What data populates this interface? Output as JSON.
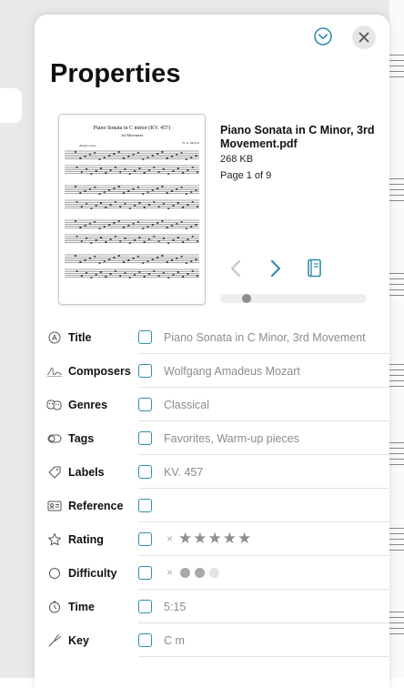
{
  "panel": {
    "title": "Properties"
  },
  "preview": {
    "file_name": "Piano Sonata in C Minor, 3rd Movement.pdf",
    "file_size": "268 KB",
    "page_info": "Page 1 of 9",
    "thumbnail": {
      "heading": "Piano Sonata in C minor (KV. 457)",
      "subheading": "3rd Movement",
      "tempo": "Allegro assai",
      "composer": "W. A. Mozart"
    }
  },
  "properties": [
    {
      "label": "Title",
      "icon": "title-icon",
      "value": "Piano Sonata in C Minor, 3rd Movement"
    },
    {
      "label": "Composers",
      "icon": "composer-signature-icon",
      "value": "Wolfgang Amadeus Mozart"
    },
    {
      "label": "Genres",
      "icon": "theater-masks-icon",
      "value": "Classical"
    },
    {
      "label": "Tags",
      "icon": "tag-toggle-icon",
      "value": "Favorites, Warm-up pieces"
    },
    {
      "label": "Labels",
      "icon": "label-tag-icon",
      "value": "KV. 457"
    },
    {
      "label": "Reference",
      "icon": "id-card-icon",
      "value": ""
    },
    {
      "label": "Rating",
      "icon": "star-icon",
      "value": "",
      "rating": 5
    },
    {
      "label": "Difficulty",
      "icon": "circle-icon",
      "value": "",
      "difficulty_level": 2,
      "difficulty_max": 3
    },
    {
      "label": "Time",
      "icon": "timer-icon",
      "value": "5:15"
    },
    {
      "label": "Key",
      "icon": "tuning-fork-icon",
      "value": "C m"
    }
  ],
  "rating_row": {
    "clear": "×",
    "stars": "★★★★★"
  },
  "difficulty_row": {
    "clear": "×"
  },
  "colors": {
    "accent": "#2f8fa8",
    "muted_text": "#8c8c90"
  }
}
